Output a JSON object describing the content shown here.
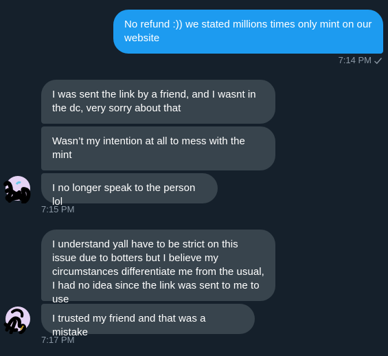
{
  "conversation": {
    "sent": [
      {
        "text": "No refund :)) we stated millions times only mint on our website",
        "time": "7:14 PM",
        "status_icon": "check-icon"
      }
    ],
    "received_group_1": {
      "messages": [
        "I was sent the link by a friend, and I wasnt in the dc, very sorry about that",
        "Wasn’t my intention at all to mess with the mint",
        "I no longer speak to the person lol"
      ],
      "time": "7:15 PM",
      "avatar_icon": "scribbled-avatar-icon"
    },
    "received_group_2": {
      "messages": [
        "I understand yall have to be strict on this issue due to botters but I believe my circumstances differentiate me from the usual, I had no idea since the link was sent to me to use",
        "I trusted my friend and that was a mistake"
      ],
      "time": "7:17 PM",
      "avatar_icon": "scribbled-avatar-icon"
    }
  },
  "colors": {
    "background": "#15202b",
    "sent_bubble": "#1d9bf0",
    "received_bubble": "#38444d",
    "timestamp": "#8b98a5",
    "text": "#ffffff"
  }
}
